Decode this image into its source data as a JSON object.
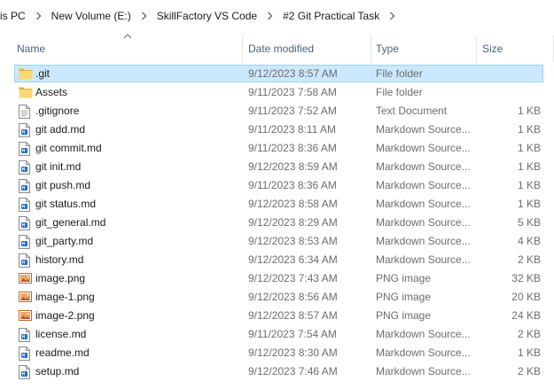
{
  "breadcrumb": [
    "is PC",
    "New Volume (E:)",
    "SkillFactory VS Code",
    "#2 Git Practical Task"
  ],
  "columns": {
    "name": "Name",
    "date": "Date modified",
    "type": "Type",
    "size": "Size"
  },
  "colors": {
    "selection": "#cce8ff",
    "selection_border": "#99d1ff",
    "folder": "#f8d775",
    "header_text": "#4c607a"
  },
  "files": [
    {
      "name": ".git",
      "date": "9/12/2023 8:57 AM",
      "type": "File folder",
      "size": "",
      "icon": "folder-icon",
      "selected": true
    },
    {
      "name": "Assets",
      "date": "9/11/2023 7:58 AM",
      "type": "File folder",
      "size": "",
      "icon": "folder-icon"
    },
    {
      "name": ".gitignore",
      "date": "9/11/2023 7:52 AM",
      "type": "Text Document",
      "size": "1 KB",
      "icon": "text-file-icon"
    },
    {
      "name": "git add.md",
      "date": "9/11/2023 8:11 AM",
      "type": "Markdown Source...",
      "size": "1 KB",
      "icon": "markdown-file-icon"
    },
    {
      "name": "git commit.md",
      "date": "9/11/2023 8:36 AM",
      "type": "Markdown Source...",
      "size": "1 KB",
      "icon": "markdown-file-icon"
    },
    {
      "name": "git init.md",
      "date": "9/12/2023 8:59 AM",
      "type": "Markdown Source...",
      "size": "1 KB",
      "icon": "markdown-file-icon"
    },
    {
      "name": "git push.md",
      "date": "9/11/2023 8:36 AM",
      "type": "Markdown Source...",
      "size": "1 KB",
      "icon": "markdown-file-icon"
    },
    {
      "name": "git status.md",
      "date": "9/12/2023 8:58 AM",
      "type": "Markdown Source...",
      "size": "1 KB",
      "icon": "markdown-file-icon"
    },
    {
      "name": "git_general.md",
      "date": "9/12/2023 8:29 AM",
      "type": "Markdown Source...",
      "size": "5 KB",
      "icon": "markdown-file-icon"
    },
    {
      "name": "git_party.md",
      "date": "9/12/2023 8:53 AM",
      "type": "Markdown Source...",
      "size": "4 KB",
      "icon": "markdown-file-icon"
    },
    {
      "name": "history.md",
      "date": "9/12/2023 6:34 AM",
      "type": "Markdown Source...",
      "size": "2 KB",
      "icon": "markdown-file-icon"
    },
    {
      "name": "image.png",
      "date": "9/12/2023 7:43 AM",
      "type": "PNG image",
      "size": "32 KB",
      "icon": "image-file-icon"
    },
    {
      "name": "image-1.png",
      "date": "9/12/2023 8:56 AM",
      "type": "PNG image",
      "size": "20 KB",
      "icon": "image-file-icon"
    },
    {
      "name": "image-2.png",
      "date": "9/12/2023 8:57 AM",
      "type": "PNG image",
      "size": "24 KB",
      "icon": "image-file-icon"
    },
    {
      "name": "license.md",
      "date": "9/11/2023 7:54 AM",
      "type": "Markdown Source...",
      "size": "2 KB",
      "icon": "markdown-file-icon"
    },
    {
      "name": "readme.md",
      "date": "9/12/2023 8:30 AM",
      "type": "Markdown Source...",
      "size": "1 KB",
      "icon": "markdown-file-icon"
    },
    {
      "name": "setup.md",
      "date": "9/12/2023 7:46 AM",
      "type": "Markdown Source...",
      "size": "2 KB",
      "icon": "markdown-file-icon"
    }
  ]
}
